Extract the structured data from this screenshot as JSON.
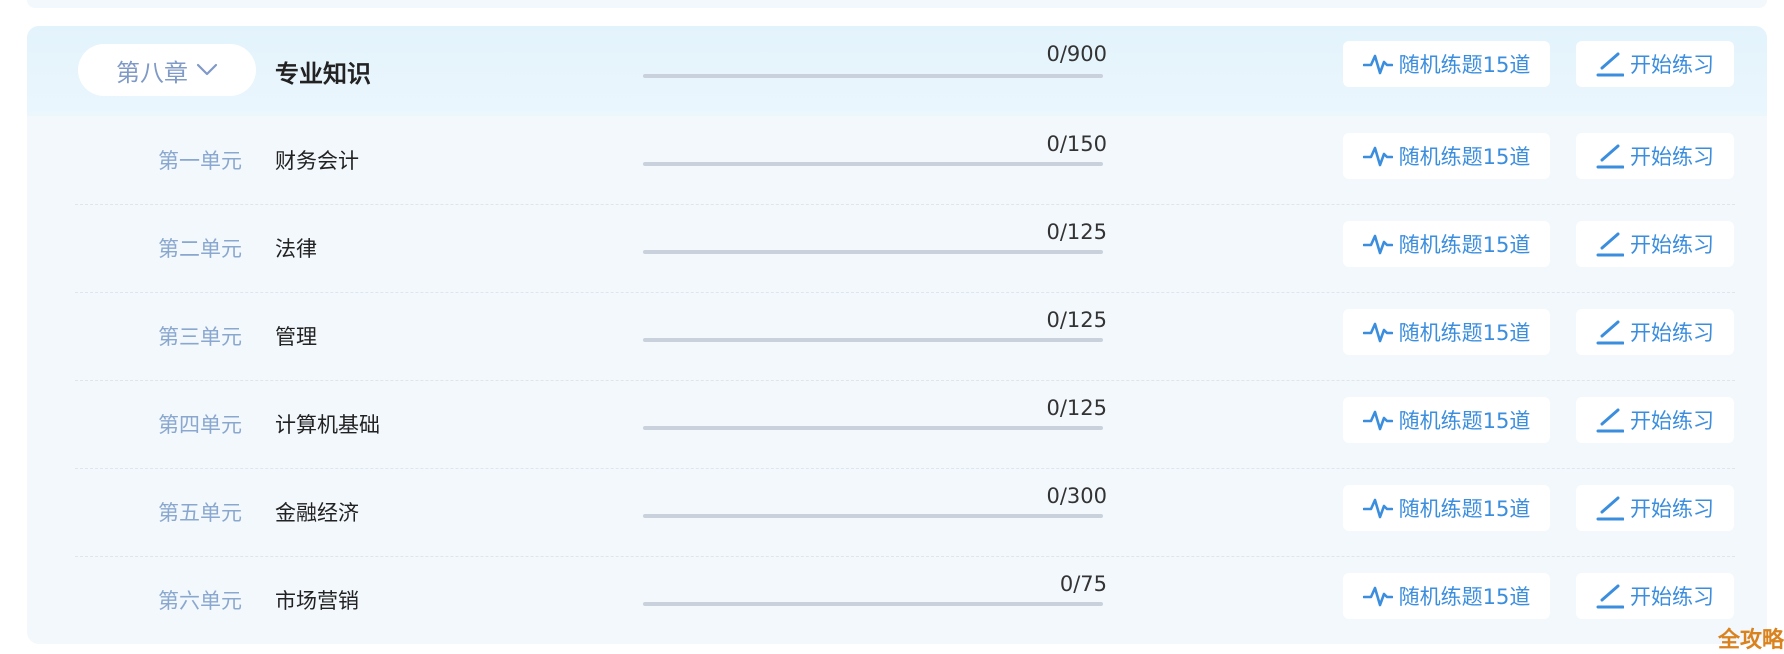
{
  "chapter": {
    "label": "第八章",
    "title": "专业知识",
    "count": "0/900",
    "progress": 0
  },
  "buttons": {
    "random_label": "随机练题15道",
    "start_label": "开始练习"
  },
  "units": [
    {
      "label": "第一单元",
      "name": "财务会计",
      "count": "0/150",
      "progress": 0
    },
    {
      "label": "第二单元",
      "name": "法律",
      "count": "0/125",
      "progress": 0
    },
    {
      "label": "第三单元",
      "name": "管理",
      "count": "0/125",
      "progress": 0
    },
    {
      "label": "第四单元",
      "name": "计算机基础",
      "count": "0/125",
      "progress": 0
    },
    {
      "label": "第五单元",
      "name": "金融经济",
      "count": "0/300",
      "progress": 0
    },
    {
      "label": "第六单元",
      "name": "市场营销",
      "count": "0/75",
      "progress": 0
    }
  ],
  "watermark": "全攻略",
  "colors": {
    "accent": "#3b8ede",
    "unit_label": "#8aa8cf",
    "panel_bg": "#f3f8fc",
    "watermark": "#d9821e"
  },
  "icons": {
    "random": "pulse-icon",
    "start": "pencil-icon",
    "chapter_toggle": "chevron-down-icon"
  }
}
